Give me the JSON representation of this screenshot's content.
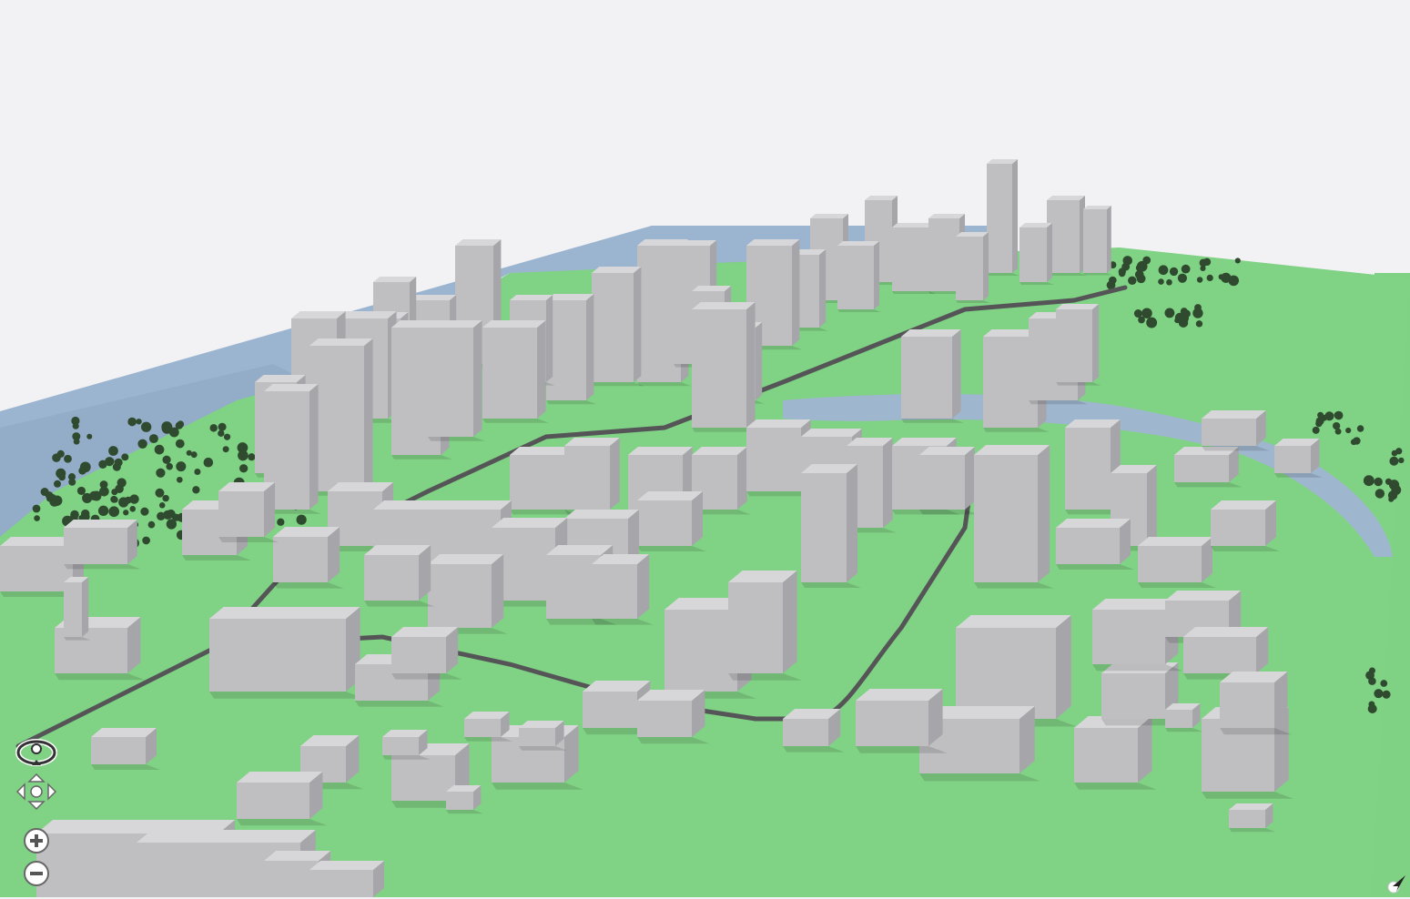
{
  "scene": {
    "sky_color": "#f2f2f5",
    "ground_color": "#7fd184",
    "water_color": "#9bb4cf",
    "river_color": "#9fb6cf",
    "building_top": "#d7d7d9",
    "building_front": "#bfbfc2",
    "building_side": "#a6a6aa",
    "tree_color": "#2f4a2f",
    "rail_color": "#555558"
  },
  "controls": {
    "compass_icon": "orbit-compass-icon",
    "pan_icon": "pan-arrows-icon",
    "zoom_in_icon": "plus-circle-icon",
    "zoom_out_icon": "minus-circle-icon",
    "north_icon": "north-arrow-icon"
  }
}
